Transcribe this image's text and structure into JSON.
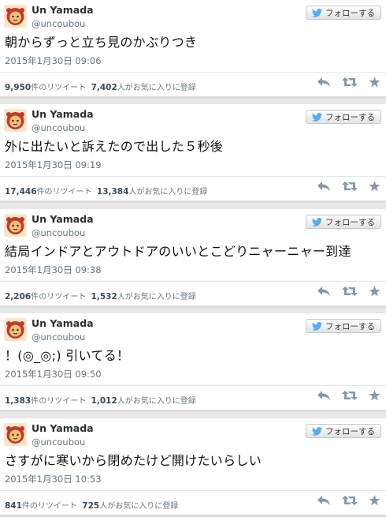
{
  "follow_label": "フォローする",
  "tweets": [
    {
      "name": "Un Yamada",
      "handle": "@uncoubou",
      "text": "朝からずっと立ち見のかぶりつき",
      "time": "2015年1月30日 09:06",
      "retweets": "9,950",
      "retweets_label": "件のリツイート",
      "favorites": "7,402",
      "favorites_label": "人がお気に入りに登録"
    },
    {
      "name": "Un Yamada",
      "handle": "@uncoubou",
      "text": "外に出たいと訴えたので出した５秒後",
      "time": "2015年1月30日 09:19",
      "retweets": "17,446",
      "retweets_label": "件のリツイート",
      "favorites": "13,384",
      "favorites_label": "人がお気に入りに登録"
    },
    {
      "name": "Un Yamada",
      "handle": "@uncoubou",
      "text": "結局インドアとアウトドアのいいとこどりニャーニャー到達",
      "time": "2015年1月30日 09:38",
      "retweets": "2,206",
      "retweets_label": "件のリツイート",
      "favorites": "1,532",
      "favorites_label": "人がお気に入りに登録"
    },
    {
      "name": "Un Yamada",
      "handle": "@uncoubou",
      "text": "！(◎_◎;) 引いてる！",
      "time": "2015年1月30日 09:50",
      "retweets": "1,383",
      "retweets_label": "件のリツイート",
      "favorites": "1,012",
      "favorites_label": "人がお気に入りに登録"
    },
    {
      "name": "Un Yamada",
      "handle": "@uncoubou",
      "text": "さすがに寒いから閉めたけど開けたいらしい",
      "time": "2015年1月30日 10:53",
      "retweets": "841",
      "retweets_label": "件のリツイート",
      "favorites": "725",
      "favorites_label": "人がお気に入りに登録"
    }
  ],
  "icons": {
    "follow": "twitter-bird-icon",
    "reply": "reply-icon",
    "retweet": "retweet-icon",
    "favorite": "star-icon",
    "avatar": "avatar-illustration"
  },
  "colors": {
    "twitter_blue": "#55acee",
    "action_gray": "#8899a6",
    "avatar_red": "#c0392b",
    "avatar_skin": "#f3c07a"
  }
}
